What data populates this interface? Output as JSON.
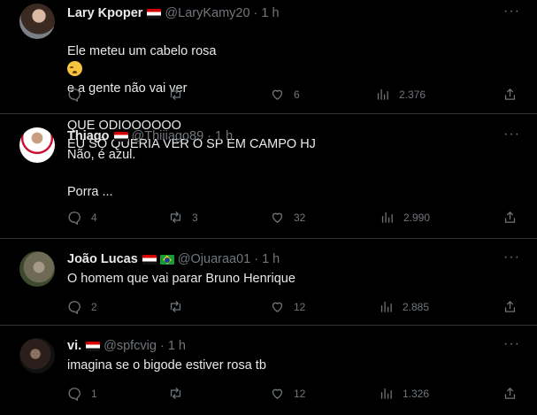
{
  "tweets": [
    {
      "name": "Lary Kpoper",
      "handle": "@LaryKamy20",
      "time": "1 h",
      "text_line1": "Ele meteu um cabelo rosa",
      "text_line1_end": "e a gente não vai ver",
      "text_rest": "QUE ODIOOOOOO\nEU SÓ QUERIA VER O SP EM CAMPO HJ",
      "replies": "",
      "retweets": "",
      "likes": "6",
      "views": "2.376"
    },
    {
      "name": "Thiago",
      "handle": "@Thiiiago89",
      "time": "1 h",
      "text": "Não, é azul.\n\nPorra ...",
      "replies": "4",
      "retweets": "3",
      "likes": "32",
      "views": "2.990"
    },
    {
      "name": "João Lucas",
      "handle": "@Ojuaraa01",
      "time": "1 h",
      "text": "O homem que vai parar Bruno Henrique",
      "replies": "2",
      "retweets": "",
      "likes": "12",
      "views": "2.885"
    },
    {
      "name": "vi.",
      "handle": "@spfcvig",
      "time": "1 h",
      "text": "imagina se o bigode estiver rosa tb",
      "replies": "1",
      "retweets": "",
      "likes": "12",
      "views": "1.326"
    }
  ],
  "separator": "·",
  "more_glyph": "···",
  "colors": {
    "background": "#000000",
    "text": "#e7e9ea",
    "muted": "#71767b",
    "divider": "#2f3336"
  },
  "icons": [
    "reply-icon",
    "retweet-icon",
    "like-icon",
    "views-icon",
    "share-icon",
    "more-icon",
    "crying-emoji-icon",
    "sao-paulo-flag-icon",
    "brazil-flag-icon"
  ]
}
